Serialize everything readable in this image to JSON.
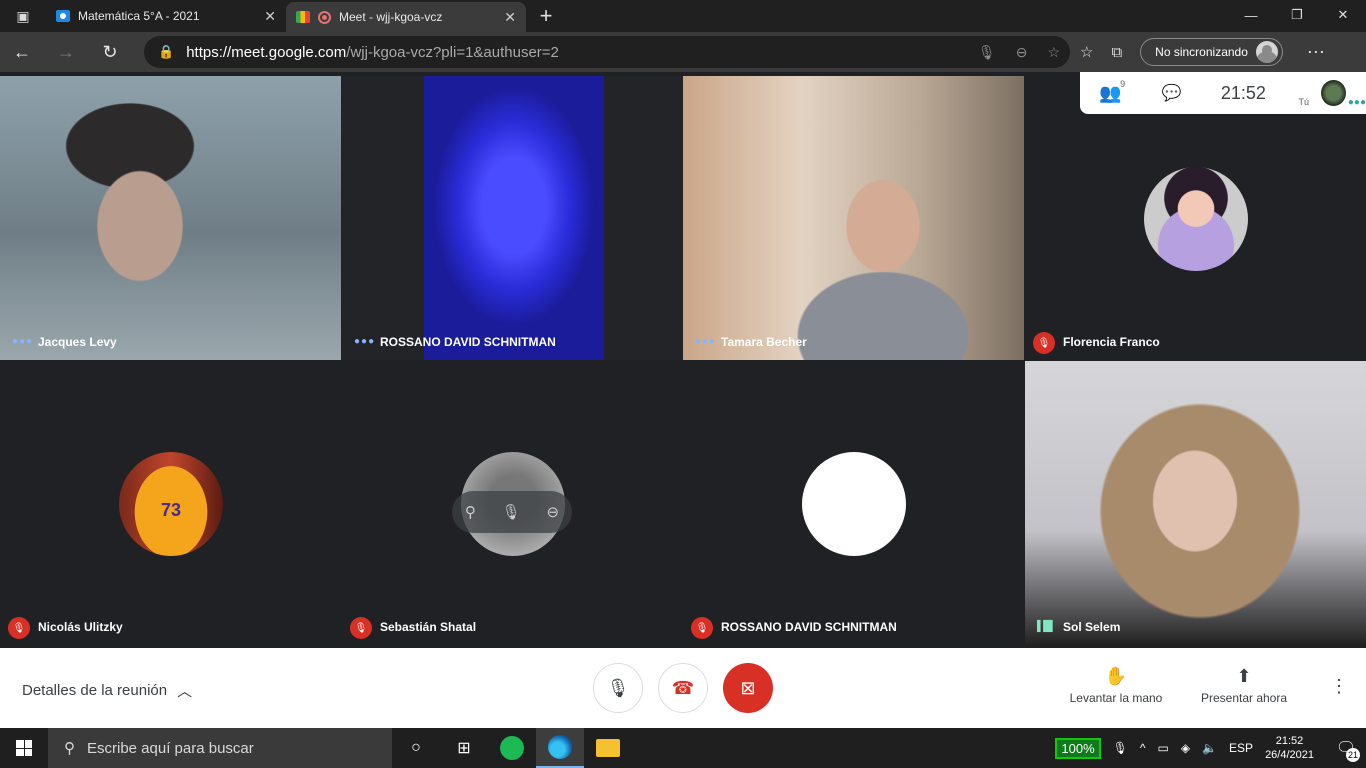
{
  "browser": {
    "tabs": [
      {
        "title": "Matemática 5°A - 2021"
      },
      {
        "title": "Meet - wjj-kgoa-vcz"
      }
    ],
    "url_host": "https://meet.google.com",
    "url_path": "/wjj-kgoa-vcz?pli=1&authuser=2",
    "sync_label": "No sincronizando"
  },
  "meet": {
    "people_count": "9",
    "clock": "21:52",
    "self_label": "Tú",
    "participants": [
      {
        "name": "Jacques Levy"
      },
      {
        "name": "ROSSANO DAVID SCHNITMAN"
      },
      {
        "name": "Tamara Becher"
      },
      {
        "name": "Florencia Franco"
      },
      {
        "name": "Nicolás Ulitzky"
      },
      {
        "name": "Sebastián Shatal"
      },
      {
        "name": "ROSSANO DAVID SCHNITMAN"
      },
      {
        "name": "Sol Selem"
      }
    ],
    "jersey_number": "73",
    "details_label": "Detalles de la reunión",
    "raise_hand_label": "Levantar la mano",
    "present_label": "Presentar ahora"
  },
  "taskbar": {
    "search_placeholder": "Escribe aquí para buscar",
    "battery": "100%",
    "language": "ESP",
    "time": "21:52",
    "date": "26/4/2021",
    "notifications": "21"
  }
}
